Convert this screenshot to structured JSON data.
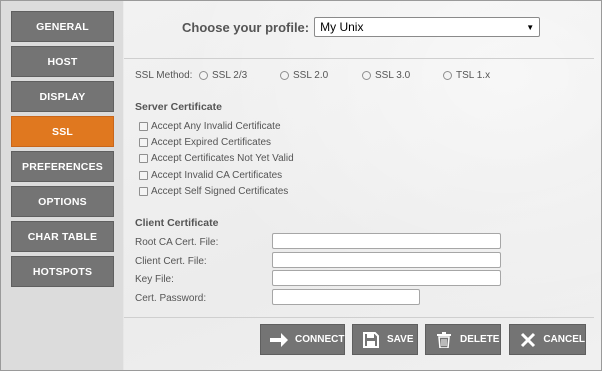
{
  "sidebar": {
    "items": [
      {
        "label": "GENERAL"
      },
      {
        "label": "HOST"
      },
      {
        "label": "DISPLAY"
      },
      {
        "label": "SSL"
      },
      {
        "label": "PREFERENCES"
      },
      {
        "label": "OPTIONS"
      },
      {
        "label": "CHAR TABLE"
      },
      {
        "label": "HOTSPOTS"
      }
    ],
    "active_item": "SSL",
    "active_color": "#e0781f",
    "button_color": "#747474"
  },
  "profile": {
    "label": "Choose your profile:",
    "selected": "My Unix"
  },
  "ssl_method": {
    "label": "SSL Method:",
    "options": [
      "SSL 2/3",
      "SSL 2.0",
      "SSL 3.0",
      "TSL 1.x"
    ]
  },
  "server_certificate": {
    "title": "Server Certificate",
    "options": [
      "Accept Any Invalid Certificate",
      "Accept Expired Certificates",
      "Accept Certificates Not Yet Valid",
      "Accept Invalid CA Certificates",
      "Accept Self Signed Certificates"
    ]
  },
  "client_certificate": {
    "title": "Client Certificate",
    "fields": [
      {
        "label": "Root CA Cert. File:",
        "value": ""
      },
      {
        "label": "Client Cert. File:",
        "value": ""
      },
      {
        "label": "Key File:",
        "value": ""
      },
      {
        "label": "Cert. Password:",
        "value": ""
      }
    ]
  },
  "actions": {
    "connect": "CONNECT",
    "save": "SAVE",
    "delete": "DELETE",
    "cancel": "CANCEL"
  }
}
